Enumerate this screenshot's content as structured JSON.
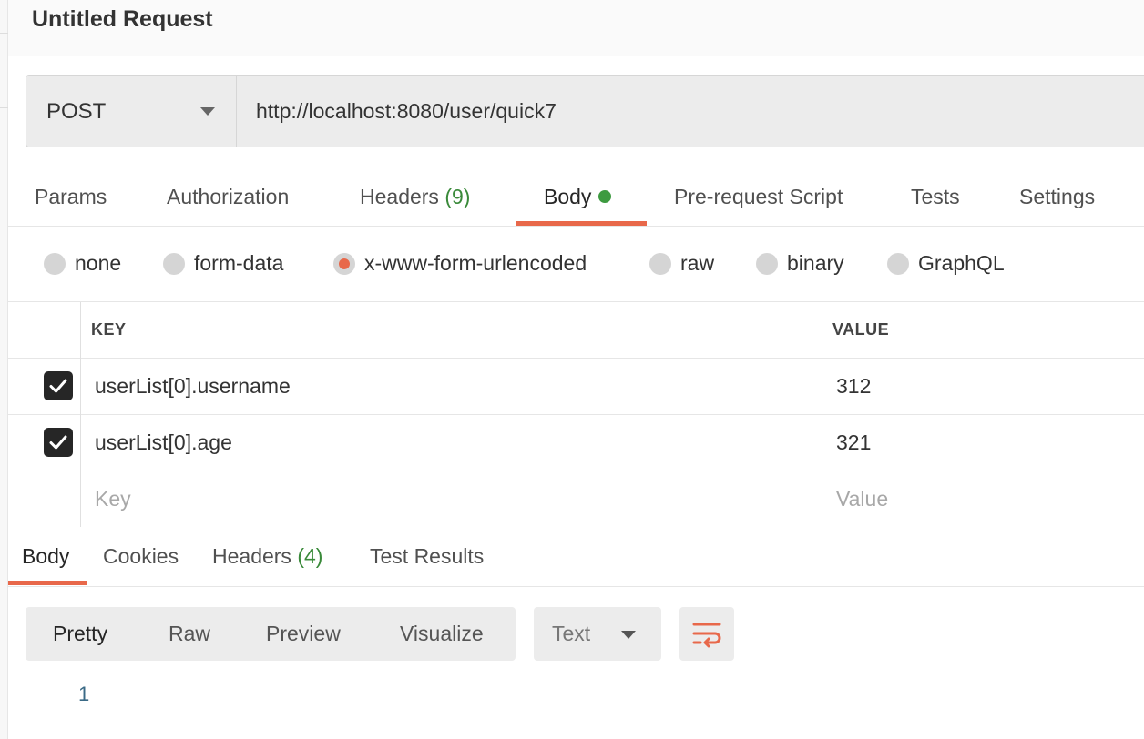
{
  "request": {
    "title": "Untitled Request",
    "method": "POST",
    "url": "http://localhost:8080/user/quick7"
  },
  "request_tabs": [
    {
      "label": "Params"
    },
    {
      "label": "Authorization"
    },
    {
      "label": "Headers",
      "count": "(9)"
    },
    {
      "label": "Body",
      "active": true,
      "indicator": "green-dot"
    },
    {
      "label": "Pre-request Script"
    },
    {
      "label": "Tests"
    },
    {
      "label": "Settings"
    }
  ],
  "body_types": [
    {
      "label": "none"
    },
    {
      "label": "form-data"
    },
    {
      "label": "x-www-form-urlencoded",
      "checked": true
    },
    {
      "label": "raw"
    },
    {
      "label": "binary"
    },
    {
      "label": "GraphQL"
    }
  ],
  "params_table": {
    "headers": {
      "key": "KEY",
      "value": "VALUE"
    },
    "rows": [
      {
        "checked": true,
        "key": "userList[0].username",
        "value": "312"
      },
      {
        "checked": true,
        "key": "userList[0].age",
        "value": "321"
      }
    ],
    "placeholder": {
      "key": "Key",
      "value": "Value"
    }
  },
  "response_tabs": [
    {
      "label": "Body",
      "active": true
    },
    {
      "label": "Cookies"
    },
    {
      "label": "Headers",
      "count": "(4)"
    },
    {
      "label": "Test Results"
    }
  ],
  "response_view": {
    "modes": [
      "Pretty",
      "Raw",
      "Preview",
      "Visualize"
    ],
    "active_mode": "Pretty",
    "format": "Text",
    "wrap_icon": "wrap-lines-icon",
    "line_numbers": [
      "1"
    ]
  },
  "colors": {
    "accent": "#e8684a",
    "indicator_green": "#3d9a40",
    "count_green": "#3a8a3a",
    "line_number": "#3b6a86"
  }
}
